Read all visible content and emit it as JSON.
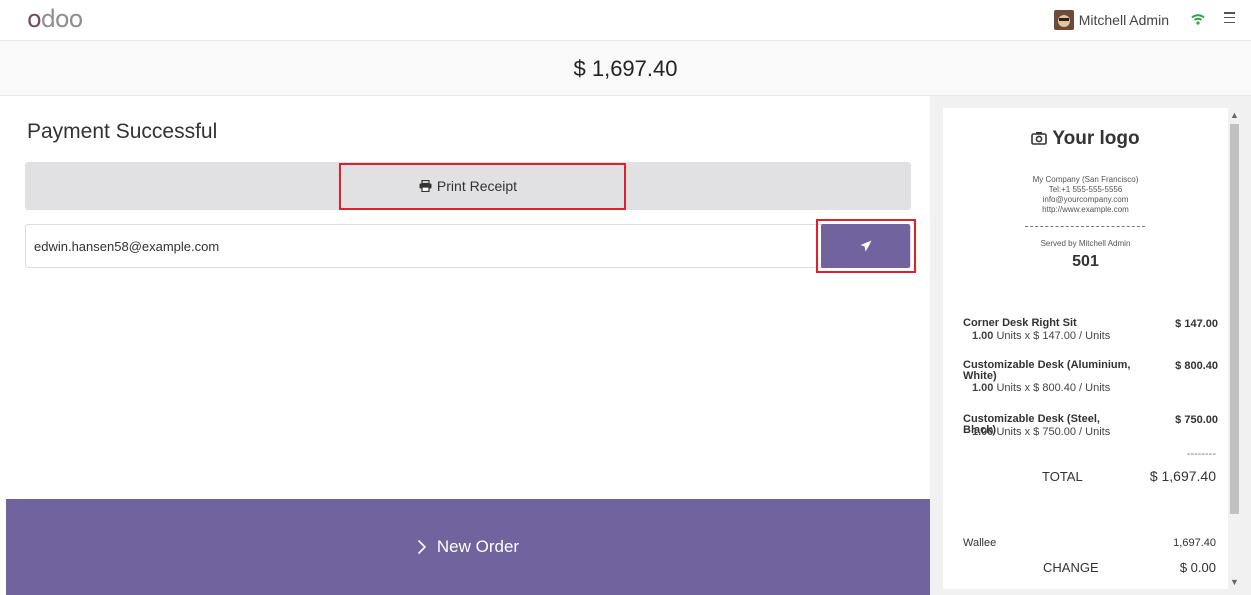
{
  "topbar": {
    "user_name": "Mitchell Admin"
  },
  "amount": "$ 1,697.40",
  "payment": {
    "title": "Payment Successful",
    "print_label": "Print Receipt",
    "email_value": "edwin.hansen58@example.com",
    "new_order_label": "New Order"
  },
  "receipt": {
    "logo_text": "Your logo",
    "company": [
      "My Company (San Francisco)",
      "Tel:+1 555-555-5556",
      "info@yourcompany.com",
      "http://www.example.com"
    ],
    "served_by": "Served by Mitchell Admin",
    "order_number": "501",
    "lines": [
      {
        "name": "Corner Desk Right Sit",
        "price": "$ 147.00",
        "qty": "1.00",
        "detail": "Units x $ 147.00 / Units"
      },
      {
        "name": "Customizable Desk (Aluminium, White)",
        "price": "$ 800.40",
        "qty": "1.00",
        "detail": "Units x $ 800.40 / Units"
      },
      {
        "name": "Customizable Desk (Steel, Black)",
        "price": "$ 750.00",
        "qty": "1.00",
        "detail": "Units x $ 750.00 / Units"
      }
    ],
    "dashes": "--------",
    "total_label": "TOTAL",
    "total_value": "$ 1,697.40",
    "payment_method": "Wallee",
    "payment_amount": "1,697.40",
    "change_label": "CHANGE",
    "change_value": "$ 0.00"
  },
  "colors": {
    "brand": "#714B67",
    "accent": "#71639e",
    "highlight": "#e0202a",
    "wifi": "#28a745"
  },
  "icons": {
    "print": "printer-icon",
    "send": "paper-plane-icon",
    "new_order": "chevron-right-icon",
    "logo": "camera-icon"
  }
}
